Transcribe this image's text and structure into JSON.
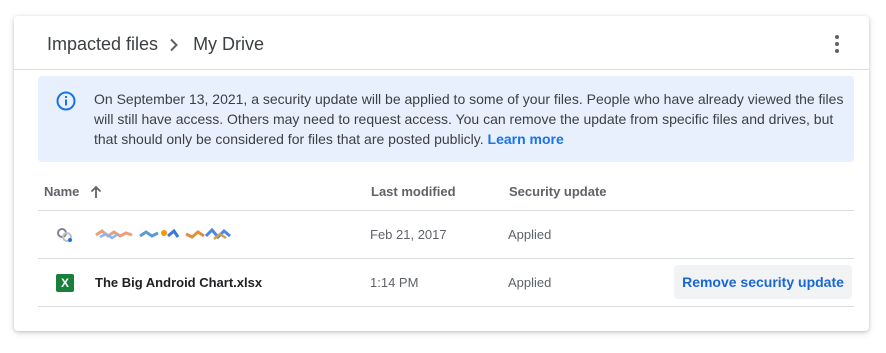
{
  "header": {
    "breadcrumb": [
      "Impacted files",
      "My Drive"
    ]
  },
  "banner": {
    "message": "On September 13, 2021, a security update will be applied to some of your files. People who have already viewed the files will still have access. Others may need to request access. You can remove the update from specific files and drives, but that should only be considered for files that are posted publicly.",
    "link": "Learn more"
  },
  "table": {
    "columns": {
      "name": "Name",
      "modified": "Last modified",
      "security": "Security update"
    },
    "rows": [
      {
        "name": "",
        "modified": "Feb 21, 2017",
        "security": "Applied",
        "icon": "shared-link-icon"
      },
      {
        "name": "The Big Android Chart.xlsx",
        "modified": "1:14 PM",
        "security": "Applied",
        "icon": "excel-file-icon",
        "icon_glyph": "X",
        "action": "Remove security update"
      }
    ]
  },
  "colors": {
    "accent": "#1a73e8",
    "banner_bg": "#e8f0fe",
    "sheets_green": "#188038"
  }
}
